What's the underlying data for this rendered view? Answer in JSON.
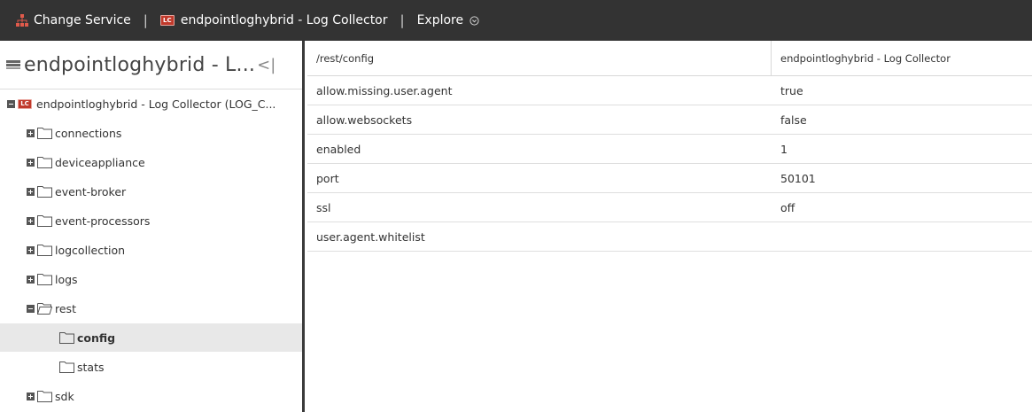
{
  "topbar": {
    "change_service_label": "Change Service",
    "separator": "|",
    "service_badge": "LC",
    "service_name": "endpointloghybrid - Log Collector",
    "explore_label": "Explore"
  },
  "left_panel": {
    "title": "endpointloghybrid - L...",
    "collapse_glyph": "<|",
    "tree": [
      {
        "label": "endpointloghybrid - Log Collector (LOG_C...",
        "badge": "LC"
      },
      {
        "label": "connections"
      },
      {
        "label": "deviceappliance"
      },
      {
        "label": "event-broker"
      },
      {
        "label": "event-processors"
      },
      {
        "label": "logcollection"
      },
      {
        "label": "logs"
      },
      {
        "label": "rest"
      },
      {
        "label": "config",
        "selected": true
      },
      {
        "label": "stats"
      },
      {
        "label": "sdk"
      }
    ]
  },
  "table": {
    "headers": [
      "/rest/config",
      "endpointloghybrid - Log Collector"
    ],
    "rows": [
      {
        "name": "allow.missing.user.agent",
        "value": "true"
      },
      {
        "name": "allow.websockets",
        "value": "false"
      },
      {
        "name": "enabled",
        "value": "1"
      },
      {
        "name": "port",
        "value": "50101"
      },
      {
        "name": "ssl",
        "value": "off"
      },
      {
        "name": "user.agent.whitelist",
        "value": ""
      }
    ]
  },
  "colors": {
    "topbar_bg": "#333333",
    "badge_red": "#c0392b",
    "network_icon": "#e05a4b",
    "selected_row_bg": "#e8e8e8"
  },
  "icons": [
    "network-icon",
    "lc-badge-icon",
    "chevron-down-circle-icon",
    "server-icon",
    "collapse-panel-icon",
    "folder-icon",
    "folder-open-icon",
    "expand-toggle-icon",
    "collapse-toggle-icon"
  ]
}
